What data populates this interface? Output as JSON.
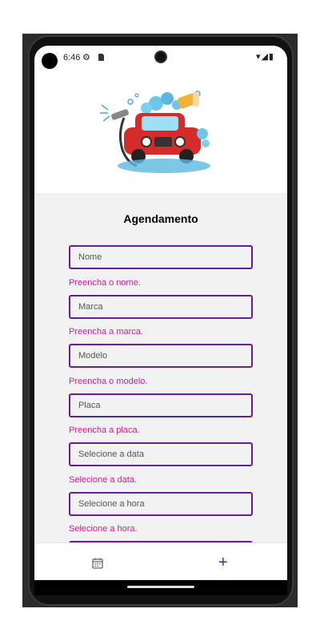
{
  "status_bar": {
    "time": "6:46"
  },
  "form": {
    "title": "Agendamento",
    "fields": [
      {
        "placeholder": "Nome",
        "error": "Preencha o nome."
      },
      {
        "placeholder": "Marca",
        "error": "Preencha a marca."
      },
      {
        "placeholder": "Modelo",
        "error": "Preencha o modelo."
      },
      {
        "placeholder": "Placa",
        "error": "Preencha a placa."
      },
      {
        "placeholder": "Selecione a data",
        "error": "Selecione a data."
      },
      {
        "placeholder": "Selecione a hora",
        "error": "Selecione a hora."
      }
    ]
  },
  "bottom_nav": {
    "left_icon": "calendar-icon",
    "right_icon": "plus-icon",
    "plus_glyph": "+"
  },
  "colors": {
    "accent": "#6a1b9a",
    "error": "#d81b8b"
  }
}
